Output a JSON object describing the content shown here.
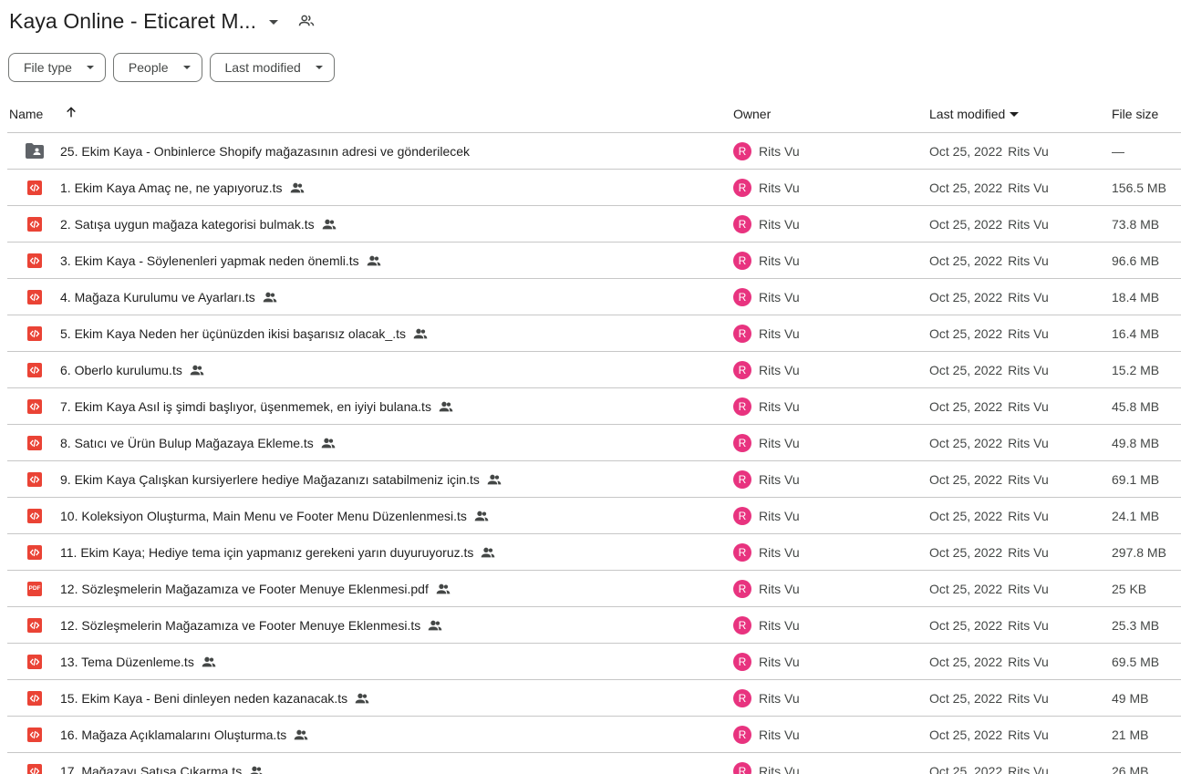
{
  "header": {
    "title": "Kaya Online - Eticaret M...",
    "title_dropdown_icon": "arrow-drop-down-icon",
    "shared_icon": "people-outline-icon"
  },
  "filters": [
    {
      "label": "File type",
      "icon": "arrow-drop-down-icon"
    },
    {
      "label": "People",
      "icon": "arrow-drop-down-icon"
    },
    {
      "label": "Last modified",
      "icon": "arrow-drop-down-icon"
    }
  ],
  "table": {
    "columns": {
      "name": "Name",
      "owner": "Owner",
      "last_modified": "Last modified",
      "file_size": "File size"
    },
    "name_sort_icon": "arrow-upward-icon",
    "rows": [
      {
        "icon": "shared-folder-icon",
        "name": "25. Ekim Kaya - Onbinlerce Shopify mağazasının adresi ve gönderilecek",
        "shared": false,
        "avatar": "R",
        "owner": "Rits Vu",
        "date": "Oct 25, 2022",
        "modified_by": "Rits Vu",
        "size": "—"
      },
      {
        "icon": "code-file-icon",
        "name": "1. Ekim Kaya Amaç ne, ne yapıyoruz.ts",
        "shared": true,
        "avatar": "R",
        "owner": "Rits Vu",
        "date": "Oct 25, 2022",
        "modified_by": "Rits Vu",
        "size": "156.5 MB"
      },
      {
        "icon": "code-file-icon",
        "name": "2. Satışa uygun mağaza kategorisi bulmak.ts",
        "shared": true,
        "avatar": "R",
        "owner": "Rits Vu",
        "date": "Oct 25, 2022",
        "modified_by": "Rits Vu",
        "size": "73.8 MB"
      },
      {
        "icon": "code-file-icon",
        "name": "3. Ekim Kaya - Söylenenleri yapmak neden önemli.ts",
        "shared": true,
        "avatar": "R",
        "owner": "Rits Vu",
        "date": "Oct 25, 2022",
        "modified_by": "Rits Vu",
        "size": "96.6 MB"
      },
      {
        "icon": "code-file-icon",
        "name": "4. Mağaza Kurulumu ve Ayarları.ts",
        "shared": true,
        "avatar": "R",
        "owner": "Rits Vu",
        "date": "Oct 25, 2022",
        "modified_by": "Rits Vu",
        "size": "18.4 MB"
      },
      {
        "icon": "code-file-icon",
        "name": "5. Ekim Kaya Neden her üçünüzden ikisi başarısız olacak_.ts",
        "shared": true,
        "avatar": "R",
        "owner": "Rits Vu",
        "date": "Oct 25, 2022",
        "modified_by": "Rits Vu",
        "size": "16.4 MB"
      },
      {
        "icon": "code-file-icon",
        "name": "6. Oberlo kurulumu.ts",
        "shared": true,
        "avatar": "R",
        "owner": "Rits Vu",
        "date": "Oct 25, 2022",
        "modified_by": "Rits Vu",
        "size": "15.2 MB"
      },
      {
        "icon": "code-file-icon",
        "name": "7. Ekim Kaya Asıl iş şimdi başlıyor, üşenmemek, en iyiyi bulana.ts",
        "shared": true,
        "avatar": "R",
        "owner": "Rits Vu",
        "date": "Oct 25, 2022",
        "modified_by": "Rits Vu",
        "size": "45.8 MB"
      },
      {
        "icon": "code-file-icon",
        "name": "8. Satıcı ve Ürün Bulup Mağazaya Ekleme.ts",
        "shared": true,
        "avatar": "R",
        "owner": "Rits Vu",
        "date": "Oct 25, 2022",
        "modified_by": "Rits Vu",
        "size": "49.8 MB"
      },
      {
        "icon": "code-file-icon",
        "name": "9. Ekim Kaya Çalışkan kursiyerlere hediye Mağazanızı satabilmeniz için.ts",
        "shared": true,
        "avatar": "R",
        "owner": "Rits Vu",
        "date": "Oct 25, 2022",
        "modified_by": "Rits Vu",
        "size": "69.1 MB"
      },
      {
        "icon": "code-file-icon",
        "name": "10. Koleksiyon Oluşturma, Main Menu ve Footer Menu Düzenlenmesi.ts",
        "shared": true,
        "avatar": "R",
        "owner": "Rits Vu",
        "date": "Oct 25, 2022",
        "modified_by": "Rits Vu",
        "size": "24.1 MB"
      },
      {
        "icon": "code-file-icon",
        "name": "11. Ekim Kaya; Hediye tema için yapmanız gerekeni yarın duyuruyoruz.ts",
        "shared": true,
        "avatar": "R",
        "owner": "Rits Vu",
        "date": "Oct 25, 2022",
        "modified_by": "Rits Vu",
        "size": "297.8 MB"
      },
      {
        "icon": "pdf-file-icon",
        "icon_text": "PDF",
        "name": "12. Sözleşmelerin Mağazamıza ve Footer Menuye Eklenmesi.pdf",
        "shared": true,
        "avatar": "R",
        "owner": "Rits Vu",
        "date": "Oct 25, 2022",
        "modified_by": "Rits Vu",
        "size": "25 KB"
      },
      {
        "icon": "code-file-icon",
        "name": "12. Sözleşmelerin Mağazamıza ve Footer Menuye Eklenmesi.ts",
        "shared": true,
        "avatar": "R",
        "owner": "Rits Vu",
        "date": "Oct 25, 2022",
        "modified_by": "Rits Vu",
        "size": "25.3 MB"
      },
      {
        "icon": "code-file-icon",
        "name": "13. Tema Düzenleme.ts",
        "shared": true,
        "avatar": "R",
        "owner": "Rits Vu",
        "date": "Oct 25, 2022",
        "modified_by": "Rits Vu",
        "size": "69.5 MB"
      },
      {
        "icon": "code-file-icon",
        "name": "15. Ekim Kaya - Beni dinleyen neden kazanacak.ts",
        "shared": true,
        "avatar": "R",
        "owner": "Rits Vu",
        "date": "Oct 25, 2022",
        "modified_by": "Rits Vu",
        "size": "49 MB"
      },
      {
        "icon": "code-file-icon",
        "name": "16. Mağaza Açıklamalarını Oluşturma.ts",
        "shared": true,
        "avatar": "R",
        "owner": "Rits Vu",
        "date": "Oct 25, 2022",
        "modified_by": "Rits Vu",
        "size": "21 MB"
      },
      {
        "icon": "code-file-icon",
        "name": "17. Mağazayı Satışa Çıkarma.ts",
        "shared": true,
        "avatar": "R",
        "owner": "Rits Vu",
        "date": "Oct 25, 2022",
        "modified_by": "Rits Vu",
        "size": "26 MB"
      }
    ]
  },
  "colors": {
    "file_icon": "#ea4335",
    "avatar": "#e8337f",
    "divider": "#c7c7c7",
    "folder_icon": "#5f6368"
  }
}
